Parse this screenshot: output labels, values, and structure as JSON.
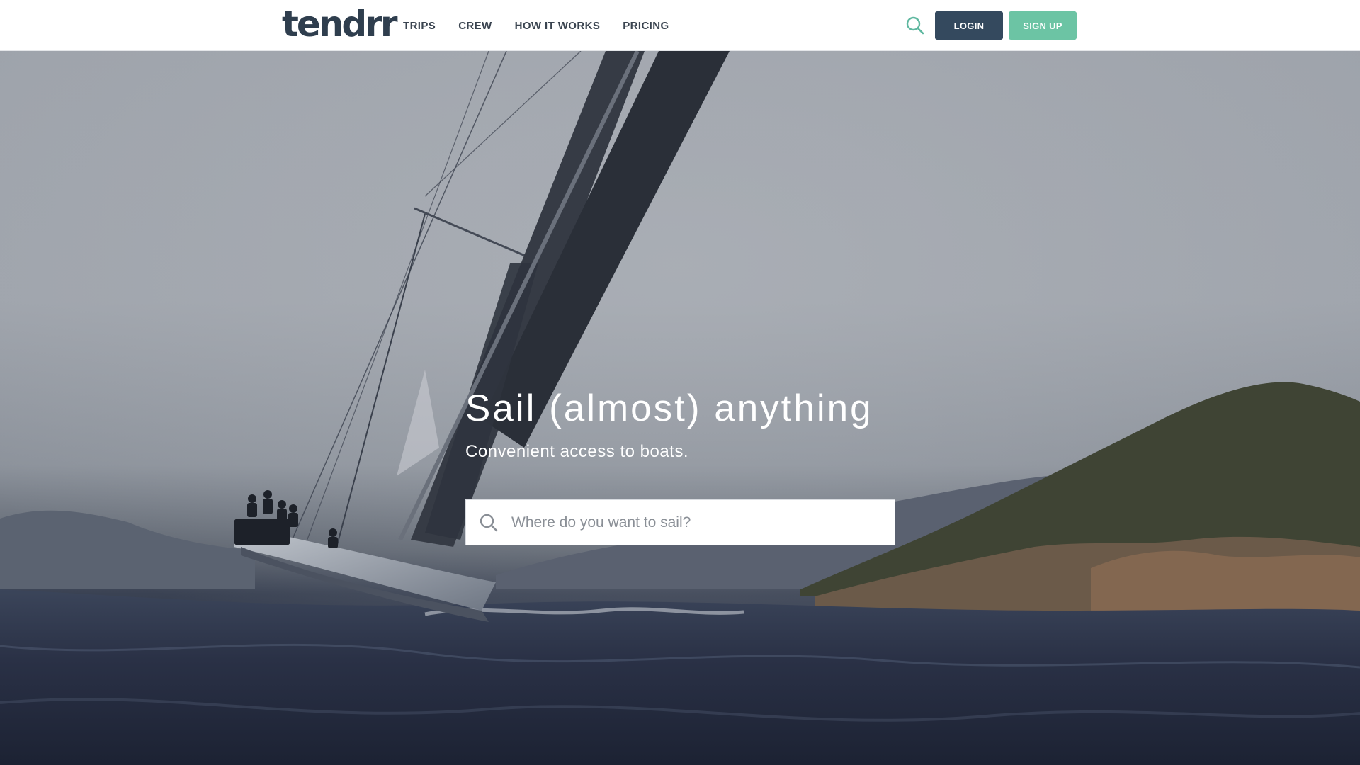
{
  "header": {
    "logo_text": "tendrr",
    "nav": [
      {
        "label": "TRIPS"
      },
      {
        "label": "CREW"
      },
      {
        "label": "HOW IT WORKS"
      },
      {
        "label": "PRICING"
      }
    ],
    "search_icon": "search-icon",
    "login_label": "LOGIN",
    "signup_label": "SIGN UP"
  },
  "hero": {
    "background": "sailboat-heeling-on-rough-sea-photo",
    "title": "Sail (almost) anything",
    "subtitle": "Convenient access to boats.",
    "search": {
      "icon": "search-icon",
      "placeholder": "Where do you want to sail?",
      "value": ""
    }
  },
  "colors": {
    "brand_dark": "#2f3e4e",
    "login_bg": "#34495e",
    "signup_bg": "#6cc4a4",
    "search_icon": "#5fb8a0"
  }
}
